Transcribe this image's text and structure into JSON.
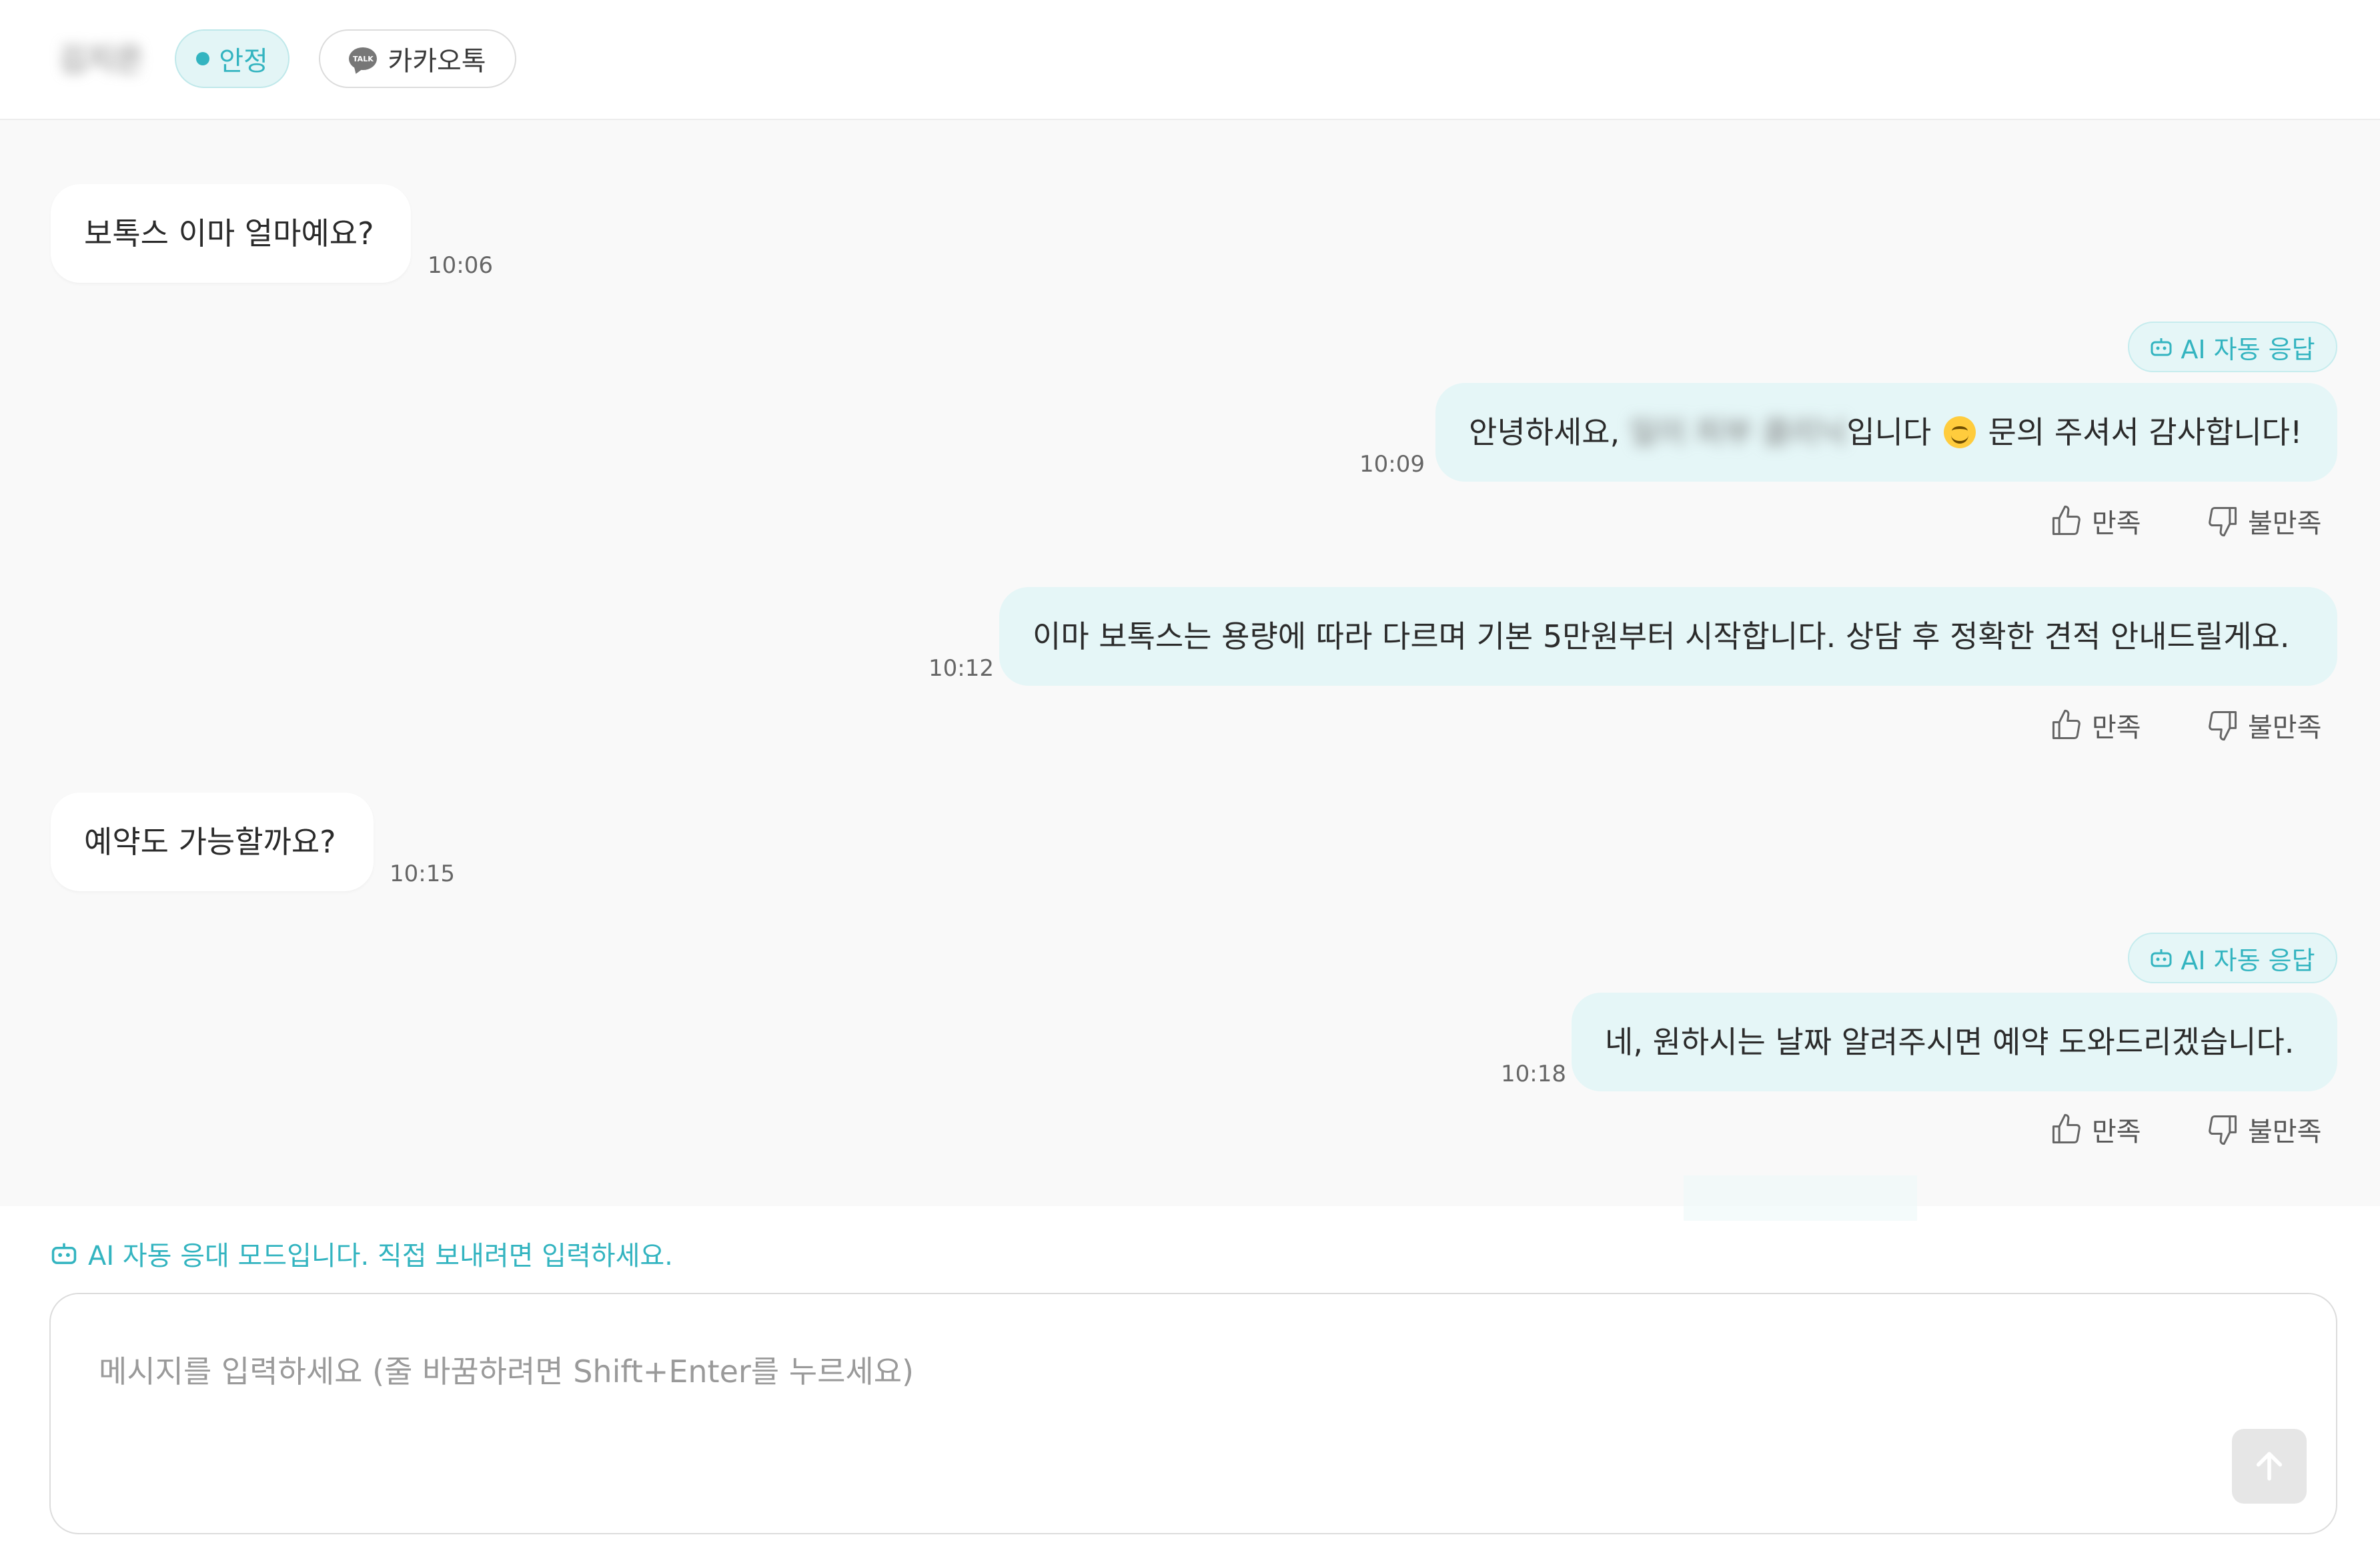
{
  "header": {
    "customer_name": "김지은",
    "status_label": "안정",
    "channel_label": "카카오톡",
    "channel_icon_text": "TALK"
  },
  "colors": {
    "accent": "#33b4c0",
    "ai_bubble": "#e5f6f7",
    "chat_background": "#f9f9f9"
  },
  "messages": [
    {
      "sender": "customer",
      "text": "보톡스 이마 얼마예요?",
      "time": "10:06"
    },
    {
      "sender": "ai",
      "badge": "AI 자동 응답",
      "text_before": "안녕하세요, ",
      "blurred_name": "일이 피부 클리닉",
      "text_after": "입니다",
      "text_end": " 문의 주셔서 감사합니다!",
      "time": "10:09",
      "like_label": "만족",
      "dislike_label": "불만족"
    },
    {
      "sender": "ai",
      "text": "이마 보톡스는 용량에 따라 다르며 기본 5만원부터 시작합니다. 상담 후 정확한 견적 안내드릴게요.",
      "time": "10:12",
      "like_label": "만족",
      "dislike_label": "불만족"
    },
    {
      "sender": "customer",
      "text": "예약도 가능할까요?",
      "time": "10:15"
    },
    {
      "sender": "ai",
      "badge": "AI 자동 응답",
      "text": "네, 원하시는 날짜 알려주시면 예약 도와드리겠습니다.",
      "time": "10:18",
      "like_label": "만족",
      "dislike_label": "불만족"
    }
  ],
  "composer": {
    "hint": "AI 자동 응대 모드입니다. 직접 보내려면 입력하세요.",
    "placeholder": "메시지를 입력하세요 (줄 바꿈하려면 Shift+Enter를 누르세요)",
    "send_icon": "arrow-up-icon"
  }
}
